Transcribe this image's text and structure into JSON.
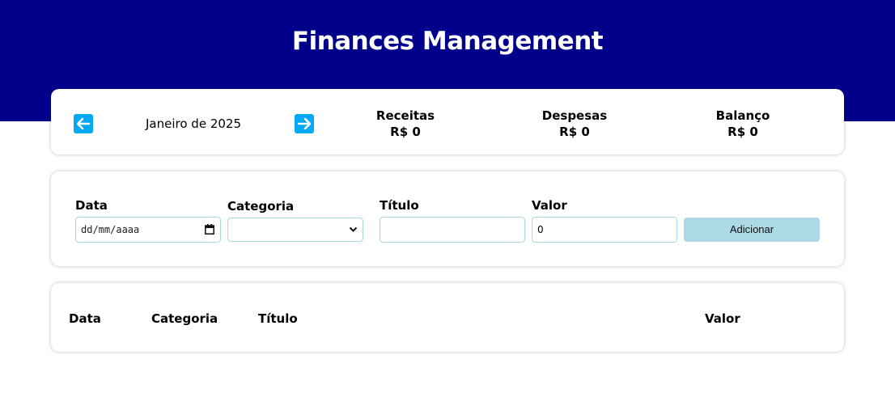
{
  "header": {
    "title": "Finances Management",
    "background_color": "#00008b"
  },
  "info": {
    "month_label": "Janeiro de 2025",
    "prev_icon": "arrow-left-icon",
    "next_icon": "arrow-right-icon",
    "arrow_color": "#03a9f4",
    "summary": {
      "receitas_label": "Receitas",
      "receitas_value": "R$ 0",
      "despesas_label": "Despesas",
      "despesas_value": "R$ 0",
      "balanco_label": "Balanço",
      "balanco_value": "R$ 0"
    }
  },
  "form": {
    "date_label": "Data",
    "date_placeholder": "dd/mm/aaaa",
    "category_label": "Categoria",
    "category_value": "",
    "title_label": "Título",
    "title_value": "",
    "value_label": "Valor",
    "value_value": "0",
    "add_button_label": "Adicionar",
    "add_button_color": "#add8e6"
  },
  "table": {
    "headers": [
      "Data",
      "Categoria",
      "Título",
      "Valor"
    ],
    "rows": []
  }
}
